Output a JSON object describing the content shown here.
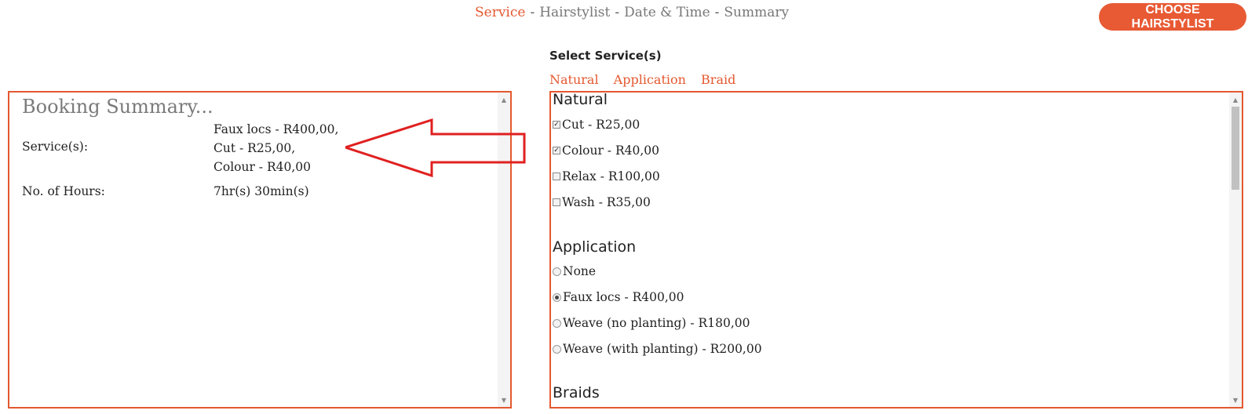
{
  "steps": {
    "items": [
      "Service",
      "Hairstylist",
      "Date & Time",
      "Summary"
    ],
    "separator": "-"
  },
  "choose_button": "CHOOSE HAIRSTYLIST",
  "select_title": "Select Service(s)",
  "category_links": [
    "Natural",
    "Application",
    "Braid"
  ],
  "summary": {
    "title": "Booking Summary...",
    "services_label": "Service(s):",
    "services_lines": [
      "Faux locs - R400,00,",
      "Cut - R25,00,",
      "Colour - R40,00"
    ],
    "hours_label": "No. of Hours:",
    "hours_value": "7hr(s) 30min(s)"
  },
  "groups": {
    "natural": {
      "title": "Natural",
      "options": [
        {
          "label": "Cut - R25,00",
          "checked": true
        },
        {
          "label": "Colour - R40,00",
          "checked": true
        },
        {
          "label": "Relax - R100,00",
          "checked": false
        },
        {
          "label": "Wash - R35,00",
          "checked": false
        }
      ]
    },
    "application": {
      "title": "Application",
      "options": [
        {
          "label": "None",
          "selected": false
        },
        {
          "label": "Faux locs - R400,00",
          "selected": true
        },
        {
          "label": "Weave (no planting) - R180,00",
          "selected": false
        },
        {
          "label": "Weave (with planting) - R200,00",
          "selected": false
        }
      ]
    },
    "braids": {
      "title": "Braids"
    }
  },
  "colors": {
    "accent": "#e4582f",
    "button": "#e85a34",
    "arrow": "#e02020"
  }
}
